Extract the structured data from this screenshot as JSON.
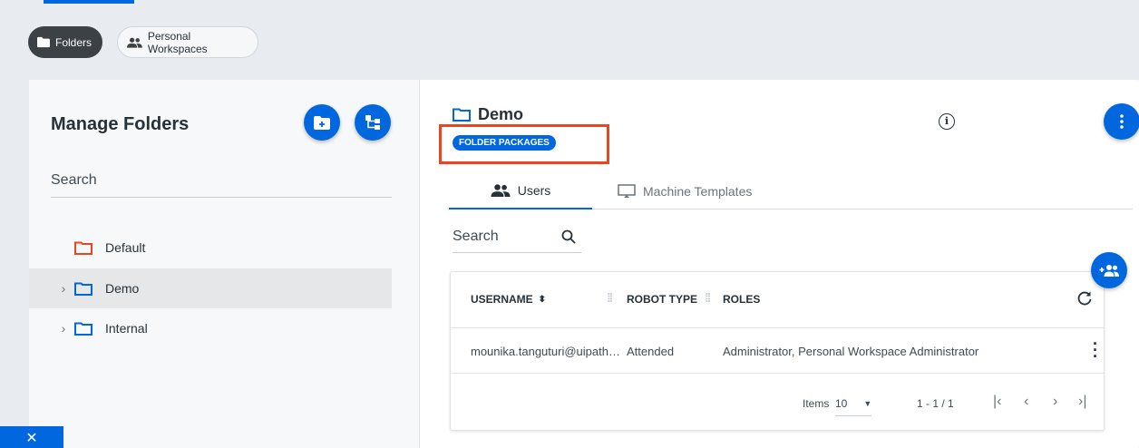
{
  "filters": {
    "folders": "Folders",
    "personal_workspaces": "Personal Workspaces"
  },
  "left": {
    "title": "Manage Folders",
    "search_placeholder": "Search",
    "tree": [
      {
        "label": "Default",
        "color": "#e8461e"
      },
      {
        "label": "Demo",
        "color": "#0067df",
        "selected": true
      },
      {
        "label": "Internal",
        "color": "#0067df"
      }
    ]
  },
  "right": {
    "folder_name": "Demo",
    "badge": "FOLDER PACKAGES",
    "tabs": {
      "users": "Users",
      "machine_templates": "Machine Templates"
    },
    "search_placeholder": "Search",
    "table": {
      "headers": {
        "username": "USERNAME",
        "robot_type": "ROBOT TYPE",
        "roles": "ROLES"
      },
      "rows": [
        {
          "username": "mounika.tanguturi@uipath…",
          "robot_type": "Attended",
          "roles": "Administrator, Personal Workspace Administrator"
        }
      ],
      "pager": {
        "items_label": "Items",
        "page_size": "10",
        "range": "1 - 1 / 1"
      }
    }
  },
  "colors": {
    "accent": "#0067df",
    "highlight": "#e8461e",
    "default_folder": "#e8461e"
  },
  "icons": [
    "folder-icon",
    "people-icon",
    "add-folder-icon",
    "tree-icon",
    "info-icon",
    "more-vert-icon",
    "machine-icon",
    "search-icon",
    "add-user-icon",
    "refresh-icon",
    "close-icon"
  ]
}
